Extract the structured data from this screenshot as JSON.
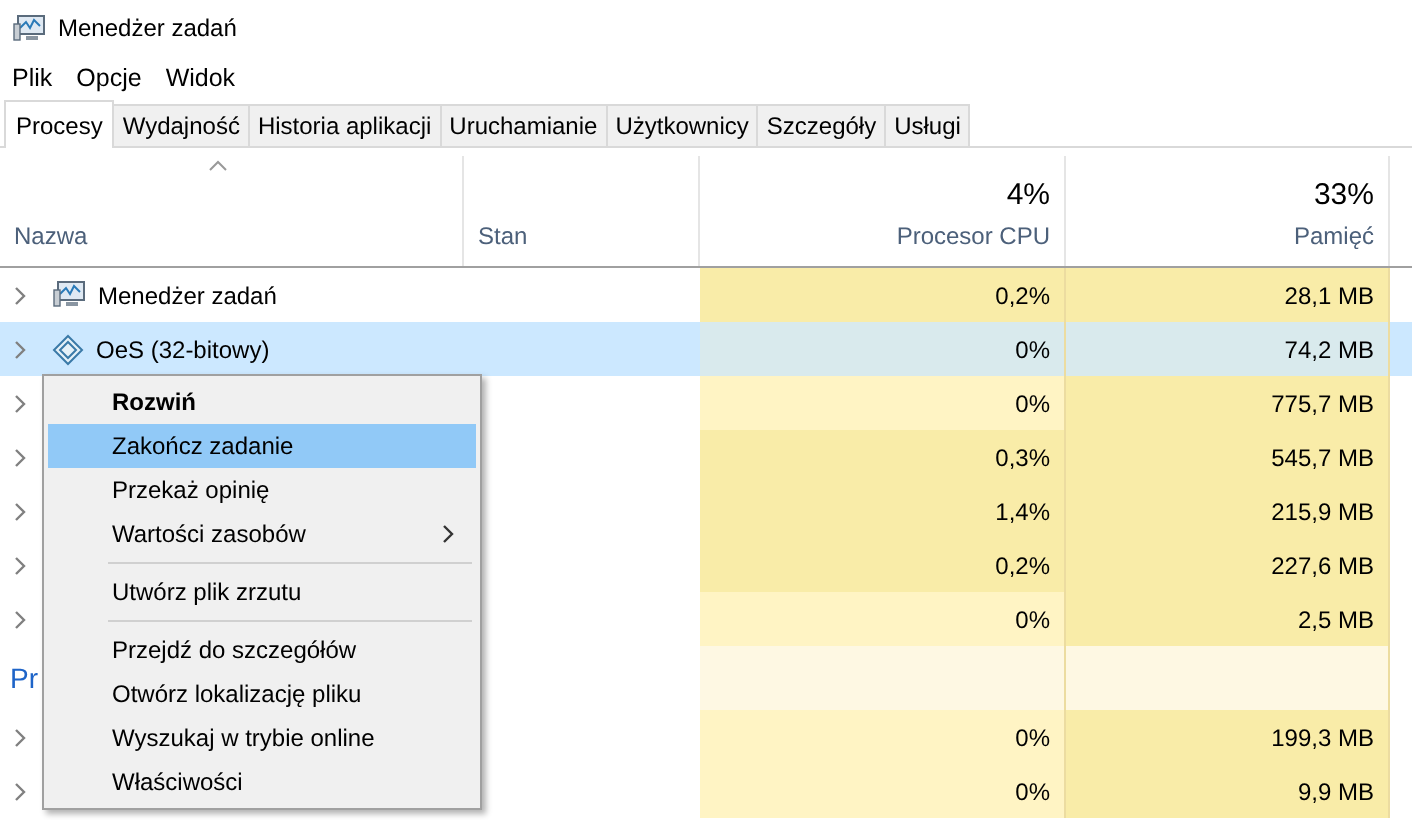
{
  "window": {
    "title": "Menedżer zadań"
  },
  "menu": [
    "Plik",
    "Opcje",
    "Widok"
  ],
  "tabs": [
    {
      "label": "Procesy",
      "selected": true
    },
    {
      "label": "Wydajność",
      "selected": false
    },
    {
      "label": "Historia aplikacji",
      "selected": false
    },
    {
      "label": "Uruchamianie",
      "selected": false
    },
    {
      "label": "Użytkownicy",
      "selected": false
    },
    {
      "label": "Szczegóły",
      "selected": false
    },
    {
      "label": "Usługi",
      "selected": false
    }
  ],
  "table": {
    "columns": [
      {
        "label": "Nazwa",
        "sorted": true
      },
      {
        "label": "Stan",
        "sorted": false
      },
      {
        "label": "Procesor CPU",
        "total": "4%",
        "sorted": false
      },
      {
        "label": "Pamięć",
        "total": "33%",
        "sorted": false
      }
    ],
    "rows": [
      {
        "kind": "process",
        "name": "Menedżer zadań",
        "selected": false,
        "cpu": {
          "text": "0,2%",
          "color": "#f9eca8"
        },
        "memory": {
          "text": "28,1 MB",
          "color": "#f9eca8"
        }
      },
      {
        "kind": "process",
        "name": "OeS (32-bitowy)",
        "selected": true,
        "cpu": {
          "text": "0%",
          "color": "#d9eaed"
        },
        "memory": {
          "text": "74,2 MB",
          "color": "#d9eaed"
        }
      },
      {
        "kind": "process",
        "selected": false,
        "cpu": {
          "text": "0%",
          "color": "#fff4c4"
        },
        "memory": {
          "text": "775,7 MB",
          "color": "#f9eca8"
        }
      },
      {
        "kind": "process",
        "selected": false,
        "cpu": {
          "text": "0,3%",
          "color": "#f9eca8"
        },
        "memory": {
          "text": "545,7 MB",
          "color": "#f9eca8"
        }
      },
      {
        "kind": "process",
        "selected": false,
        "cpu": {
          "text": "1,4%",
          "color": "#f9eca8"
        },
        "memory": {
          "text": "215,9 MB",
          "color": "#f9eca8"
        }
      },
      {
        "kind": "process",
        "selected": false,
        "cpu": {
          "text": "0,2%",
          "color": "#f9eca8"
        },
        "memory": {
          "text": "227,6 MB",
          "color": "#f9eca8"
        }
      },
      {
        "kind": "process",
        "selected": false,
        "cpu": {
          "text": "0%",
          "color": "#fff4c4"
        },
        "memory": {
          "text": "2,5 MB",
          "color": "#f9eca8"
        }
      },
      {
        "kind": "group",
        "name": "Pr"
      },
      {
        "kind": "process",
        "selected": false,
        "cpu": {
          "text": "0%",
          "color": "#fff4c4"
        },
        "memory": {
          "text": "199,3 MB",
          "color": "#f9eca8"
        }
      },
      {
        "kind": "process",
        "selected": false,
        "cpu": {
          "text": "0%",
          "color": "#fff4c4"
        },
        "memory": {
          "text": "9,9 MB",
          "color": "#f9eca8"
        }
      }
    ]
  },
  "context_menu": [
    {
      "kind": "item",
      "label": "Rozwiń",
      "bold": true,
      "selected": false,
      "submenu": false
    },
    {
      "kind": "item",
      "label": "Zakończ zadanie",
      "bold": false,
      "selected": true,
      "submenu": false
    },
    {
      "kind": "item",
      "label": "Przekaż opinię",
      "bold": false,
      "selected": false,
      "submenu": false
    },
    {
      "kind": "item",
      "label": "Wartości zasobów",
      "bold": false,
      "selected": false,
      "submenu": true
    },
    {
      "kind": "separator"
    },
    {
      "kind": "item",
      "label": "Utwórz plik zrzutu",
      "bold": false,
      "selected": false,
      "submenu": false
    },
    {
      "kind": "separator"
    },
    {
      "kind": "item",
      "label": "Przejdź do szczegółów",
      "bold": false,
      "selected": false,
      "submenu": false
    },
    {
      "kind": "item",
      "label": "Otwórz lokalizację pliku",
      "bold": false,
      "selected": false,
      "submenu": false
    },
    {
      "kind": "item",
      "label": "Wyszukaj w trybie online",
      "bold": false,
      "selected": false,
      "submenu": false
    },
    {
      "kind": "item",
      "label": "Właściwości",
      "bold": false,
      "selected": false,
      "submenu": false
    }
  ]
}
